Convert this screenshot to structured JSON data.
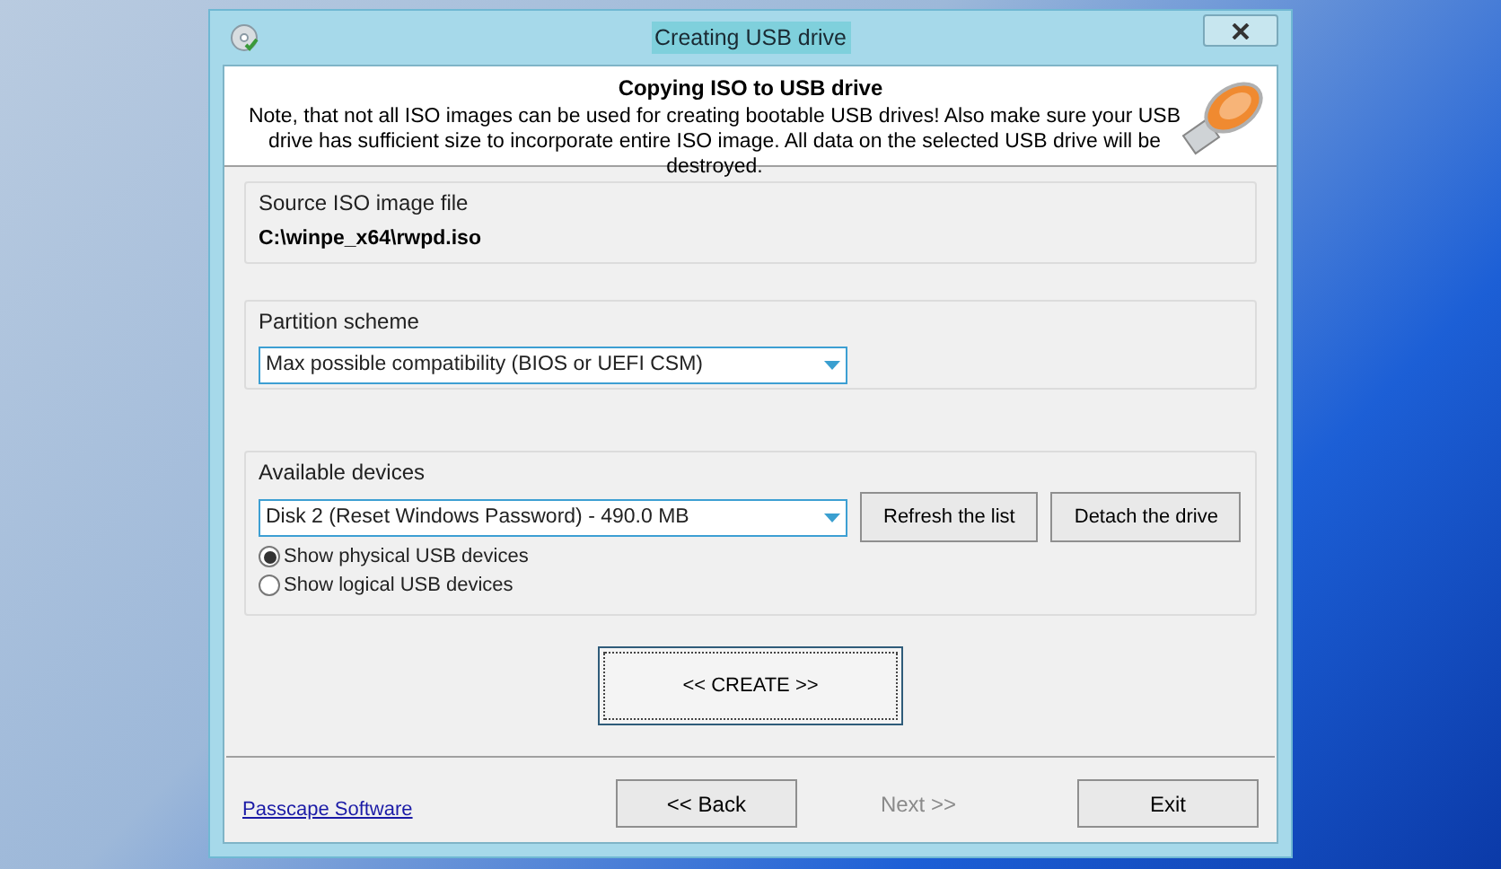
{
  "window": {
    "title": "Creating USB drive"
  },
  "header": {
    "title": "Copying ISO to USB drive",
    "note": "Note, that not all ISO images can be used for creating bootable USB drives! Also make sure your USB drive has sufficient size to incorporate entire ISO image. All data on the selected USB drive will be destroyed."
  },
  "source": {
    "label": "Source ISO image file",
    "value": "C:\\winpe_x64\\rwpd.iso"
  },
  "partition": {
    "label": "Partition scheme",
    "value": "Max possible compatibility (BIOS or UEFI CSM)"
  },
  "devices": {
    "label": "Available devices",
    "value": "Disk 2 (Reset Windows Password) - 490.0 MB",
    "buttons": [
      "Refresh the list",
      "Detach the drive"
    ],
    "options": [
      {
        "label": "Show physical USB devices",
        "selected": true
      },
      {
        "label": "Show logical USB devices",
        "selected": false
      }
    ]
  },
  "create_button": "<< CREATE >>",
  "footer": {
    "link": "Passcape Software",
    "buttons": [
      {
        "label": "<< Back",
        "disabled": false
      },
      {
        "label": "Next >>",
        "disabled": true
      },
      {
        "label": "Exit",
        "disabled": false
      }
    ]
  }
}
